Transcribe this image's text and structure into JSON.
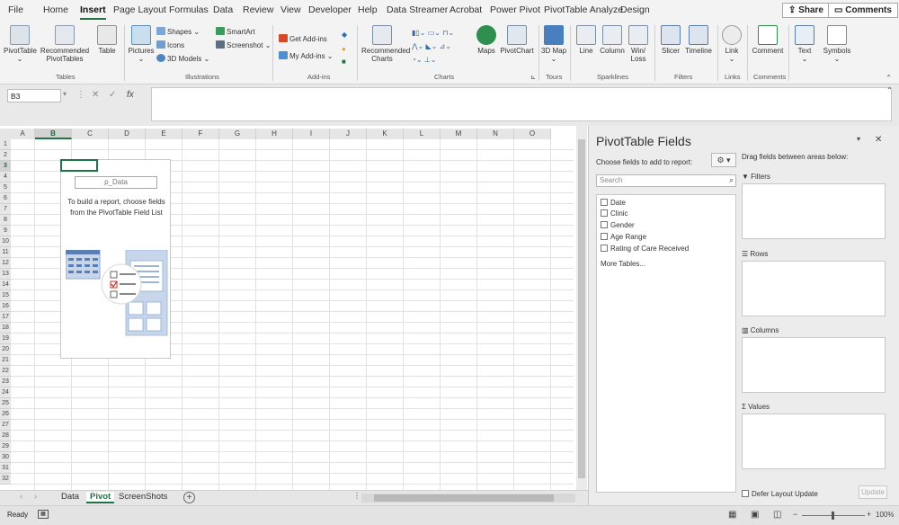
{
  "menu": {
    "tabs": [
      "File",
      "Home",
      "Insert",
      "Page Layout",
      "Formulas",
      "Data",
      "Review",
      "View",
      "Developer",
      "Help",
      "Data Streamer",
      "Acrobat",
      "Power Pivot",
      "PivotTable Analyze",
      "Design"
    ],
    "active": "Insert",
    "share": "Share",
    "comments": "Comments"
  },
  "ribbon": {
    "tables": {
      "label": "Tables",
      "pivottable": "PivotTable",
      "recommended": "Recommended PivotTables",
      "table": "Table"
    },
    "illustrations": {
      "label": "Illustrations",
      "pictures": "Pictures",
      "shapes": "Shapes",
      "icons": "Icons",
      "models": "3D Models",
      "smartart": "SmartArt",
      "screenshot": "Screenshot"
    },
    "addins": {
      "label": "Add-ins",
      "get": "Get Add-ins",
      "my": "My Add-ins"
    },
    "charts": {
      "label": "Charts",
      "recommended": "Recommended Charts",
      "maps": "Maps",
      "pivotchart": "PivotChart"
    },
    "tours": {
      "label": "Tours",
      "map3d": "3D Map"
    },
    "sparklines": {
      "label": "Sparklines",
      "line": "Line",
      "column": "Column",
      "winloss": "Win/ Loss"
    },
    "filters": {
      "label": "Filters",
      "slicer": "Slicer",
      "timeline": "Timeline"
    },
    "links": {
      "label": "Links",
      "link": "Link"
    },
    "comments": {
      "label": "Comments",
      "comment": "Comment"
    },
    "text": {
      "text": "Text"
    },
    "symbols": {
      "symbols": "Symbols"
    }
  },
  "formula_bar": {
    "namebox": "B3",
    "fx": "fx",
    "value": ""
  },
  "grid": {
    "columns": [
      "A",
      "B",
      "C",
      "D",
      "E",
      "F",
      "G",
      "H",
      "I",
      "J",
      "K",
      "L",
      "M",
      "N",
      "O"
    ],
    "rows": [
      "1",
      "2",
      "3",
      "4",
      "5",
      "6",
      "7",
      "8",
      "9",
      "10",
      "11",
      "12",
      "13",
      "14",
      "15",
      "16",
      "17",
      "18",
      "19",
      "20",
      "21",
      "22",
      "23",
      "24",
      "25",
      "26",
      "27",
      "28",
      "29",
      "30",
      "31",
      "32"
    ],
    "selected_col": "B",
    "selected_row": "3"
  },
  "pivot_placeholder": {
    "name": "p_Data",
    "hint": "To build a report, choose fields from the PivotTable Field List"
  },
  "sheets": {
    "tabs": [
      "Data",
      "Pivot",
      "ScreenShots"
    ],
    "active": "Pivot"
  },
  "status": {
    "ready": "Ready",
    "zoom": "100%"
  },
  "pane": {
    "title": "PivotTable Fields",
    "choose": "Choose fields to add to report:",
    "drag": "Drag fields between areas below:",
    "search_placeholder": "Search",
    "fields": [
      "Date",
      "Clinic",
      "Gender",
      "Age Range",
      "Rating of Care Received"
    ],
    "more_tables": "More Tables...",
    "areas": [
      "Filters",
      "Rows",
      "Columns",
      "Values"
    ],
    "defer": "Defer Layout Update",
    "update": "Update"
  },
  "colors": {
    "accent": "#217346",
    "ribbon_bg": "#f3f3f3",
    "pane_bg": "#ececec"
  }
}
